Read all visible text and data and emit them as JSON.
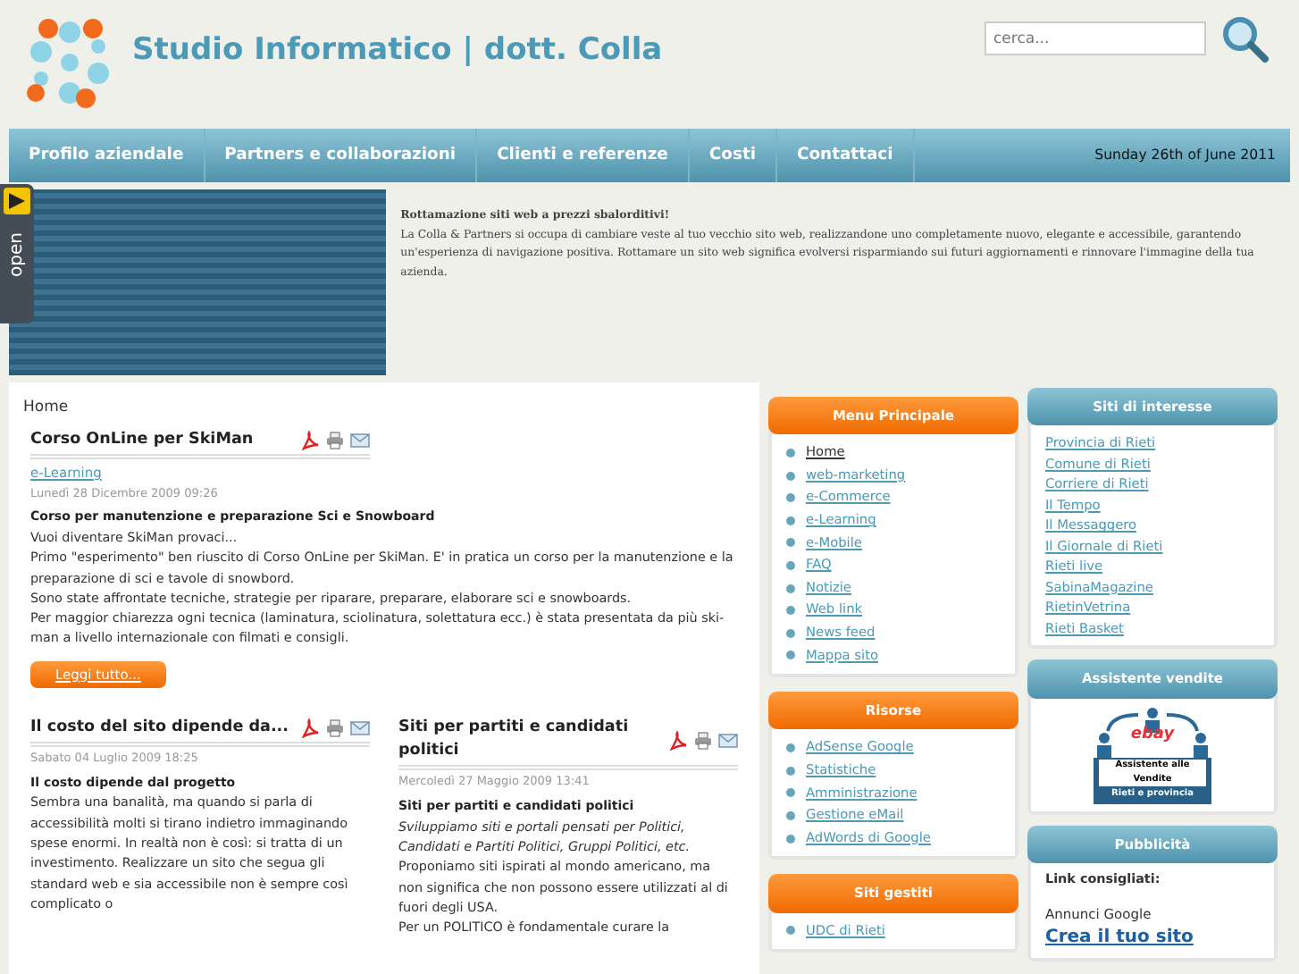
{
  "header": {
    "title": "Studio Informatico | dott. Colla",
    "search": {
      "placeholder": "cerca..."
    }
  },
  "nav": {
    "items": [
      {
        "label": "Profilo aziendale"
      },
      {
        "label": "Partners e collaborazioni"
      },
      {
        "label": "Clienti e referenze"
      },
      {
        "label": "Costi"
      },
      {
        "label": "Contattaci"
      }
    ],
    "date": "Sunday 26th of June 2011"
  },
  "side_tab": {
    "label": "open"
  },
  "banner": {
    "heading": "Rottamazione siti web a prezzi sbalorditivi!",
    "text": "La Colla & Partners  si occupa di cambiare veste al tuo vecchio sito web, realizzandone uno completamente nuovo, elegante e accessibile, garantendo un'esperienza di navigazione positiva. Rottamare un sito web significa evolversi risparmiando sui futuri aggiornamenti e rinnovare l'immagine della tua azienda."
  },
  "breadcrumb": "Home",
  "featured": {
    "title": "Corso OnLine per SkiMan",
    "category": "e-Learning",
    "date": "Lunedì 28 Dicembre 2009 09:26",
    "subtitle": "Corso per manutenzione e preparazione Sci e Snowboard",
    "paragraphs": [
      "Vuoi diventare SkiMan provaci...",
      "Primo \"esperimento\" ben riuscito di Corso OnLine per SkiMan. E' in pratica un corso per la manutenzione e la preparazione di sci e tavole di snowbord.",
      "Sono state affrontate tecniche, strategie per riparare, preparare, elaborare sci e snowboards.",
      "Per maggior chiarezza ogni tecnica (laminatura, sciolinatura, solettatura ecc.) è stata presentata da più ski-man a livello internazionale con filmati e consigli."
    ],
    "button": "Leggi tutto..."
  },
  "articles": [
    {
      "title": "Il costo del sito dipende da...",
      "date": "Sabato 04 Luglio 2009 18:25",
      "subtitle": "Il costo dipende dal progetto",
      "paragraphs": [
        {
          "kind": "normal",
          "text": "Sembra una banalità, ma quando si parla di accessibilità molti si tirano indietro immaginando spese enormi. In realtà non è così: si tratta di un investimento. Realizzare un sito che segua gli standard web e sia accessibile non è sempre così complicato o"
        }
      ]
    },
    {
      "title": "Siti per partiti e candidati politici",
      "date": "Mercoledì 27 Maggio 2009 13:41",
      "subtitle": "Siti per partiti e candidati politici",
      "paragraphs": [
        {
          "kind": "italic",
          "text": "Sviluppiamo siti e portali pensati per Politici, Candidati e Partiti Politici, Gruppi Politici, etc."
        },
        {
          "kind": "normal",
          "text": "Proponiamo siti ispirati al mondo americano, ma non significa che non possono essere utilizzati al di fuori degli USA."
        },
        {
          "kind": "normal",
          "text": "Per un POLITICO è fondamentale curare la"
        }
      ]
    }
  ],
  "menus": [
    {
      "title": "Menu Principale",
      "items": [
        {
          "label": "Home",
          "selected": true
        },
        {
          "label": "web-marketing",
          "selected": false
        },
        {
          "label": "e-Commerce",
          "selected": false
        },
        {
          "label": "e-Learning",
          "selected": false
        },
        {
          "label": "e-Mobile",
          "selected": false
        },
        {
          "label": "FAQ",
          "selected": false
        },
        {
          "label": "Notizie",
          "selected": false
        },
        {
          "label": "Web link",
          "selected": false
        },
        {
          "label": "News feed",
          "selected": false
        },
        {
          "label": "Mappa sito",
          "selected": false
        }
      ]
    },
    {
      "title": "Risorse",
      "items": [
        {
          "label": "AdSense Google",
          "selected": false
        },
        {
          "label": "Statistiche",
          "selected": false
        },
        {
          "label": "Amministrazione",
          "selected": false
        },
        {
          "label": "Gestione eMail",
          "selected": false
        },
        {
          "label": "AdWords di Google",
          "selected": false
        }
      ]
    },
    {
      "title": "Siti gestiti",
      "items": [
        {
          "label": "UDC di Rieti",
          "selected": false
        }
      ]
    }
  ],
  "right_boxes": [
    {
      "kind": "links",
      "title": "Siti di interesse",
      "links": [
        "Provincia di Rieti",
        "Comune di Rieti",
        "Corriere di Rieti",
        "Il Tempo",
        "Il Messaggero",
        "Il Giornale di Rieti",
        "Rieti live",
        "SabinaMagazine",
        "RietinVetrina",
        "Rieti Basket"
      ]
    },
    {
      "kind": "badge",
      "title": "Assistente vendite",
      "logo": "ebay",
      "caption": "Assistente alle Vendite",
      "region": "Rieti e provincia"
    },
    {
      "kind": "ads",
      "title": "Pubblicità",
      "label": "Link consigliati:",
      "ads_by": "Annunci Google",
      "ad_title": "Crea il tuo sito"
    }
  ]
}
